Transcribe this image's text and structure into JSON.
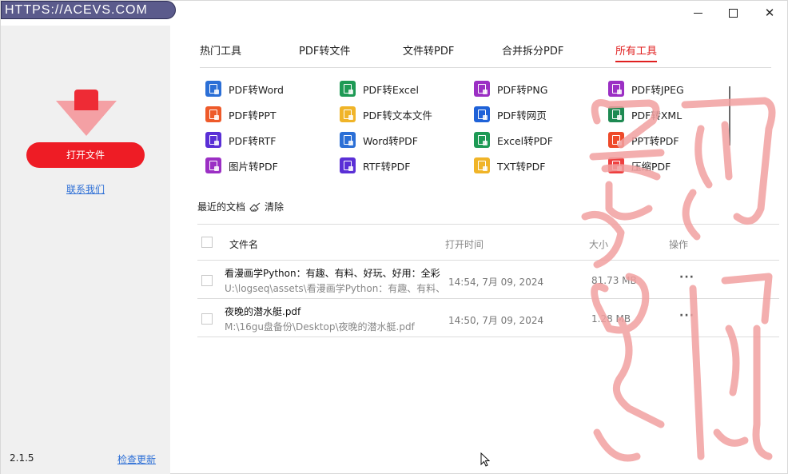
{
  "badge": "HTTPS://ACEVS.COM",
  "window_controls": {
    "minimize": "minimize-icon",
    "maximize": "maximize-icon",
    "close": "✕"
  },
  "sidebar": {
    "open_button": "打开文件",
    "contact_link": "联系我们",
    "version": "2.1.5",
    "check_update": "检查更新"
  },
  "tabs": [
    {
      "label": "热门工具",
      "active": false
    },
    {
      "label": "PDF转文件",
      "active": false
    },
    {
      "label": "文件转PDF",
      "active": false
    },
    {
      "label": "合并拆分PDF",
      "active": false
    },
    {
      "label": "所有工具",
      "active": true
    }
  ],
  "tools": [
    {
      "label": "PDF转Word",
      "color": "#2b6fd6"
    },
    {
      "label": "PDF转Excel",
      "color": "#1e9a55"
    },
    {
      "label": "PDF转PNG",
      "color": "#9b2fc4"
    },
    {
      "label": "PDF转JPEG",
      "color": "#9b2fc4"
    },
    {
      "label": "PDF转PPT",
      "color": "#ee5a2a"
    },
    {
      "label": "PDF转文本文件",
      "color": "#f0b428"
    },
    {
      "label": "PDF转网页",
      "color": "#1f62d8"
    },
    {
      "label": "PDF转XML",
      "color": "#1e8a52"
    },
    {
      "label": "PDF转RTF",
      "color": "#5a2fd6"
    },
    {
      "label": "Word转PDF",
      "color": "#2b6fd6"
    },
    {
      "label": "Excel转PDF",
      "color": "#1e9a55"
    },
    {
      "label": "PPT转PDF",
      "color": "#ee4a2a"
    },
    {
      "label": "图片转PDF",
      "color": "#9b2fc4"
    },
    {
      "label": "RTF转PDF",
      "color": "#5a2fd6"
    },
    {
      "label": "TXT转PDF",
      "color": "#f0b428"
    },
    {
      "label": "压缩PDF",
      "color": "#ee4040"
    }
  ],
  "recent": {
    "title": "最近的文档",
    "clear": "清除",
    "columns": {
      "name": "文件名",
      "time": "打开时间",
      "size": "大小",
      "action": "操作"
    },
    "rows": [
      {
        "name": "看漫画学Python：有趣、有料、好玩、好用：全彩",
        "path": "U:\\logseq\\assets\\看漫画学Python：有趣、有料、",
        "time": "14:54, 7月 09, 2024",
        "size": "81.73 MB",
        "more": "···"
      },
      {
        "name": "夜晚的潜水艇.pdf",
        "path": "M:\\16gu盘备份\\Desktop\\夜晚的潜水艇.pdf",
        "time": "14:50, 7月 09, 2024",
        "size": "1.28 MB",
        "more": "···"
      }
    ]
  },
  "colors": {
    "accent": "#ee1c25",
    "link": "#2d6fd6",
    "sidebar_bg": "#f0f0f0",
    "seal": "#f2a0a0"
  }
}
